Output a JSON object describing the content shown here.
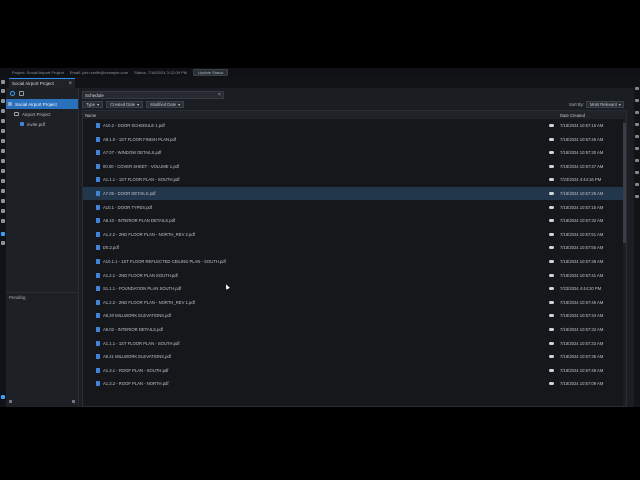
{
  "topbar": {
    "project": "Project: Social Airport Project",
    "user": "Email: john.smith@example.com",
    "status": "Status: 7/18/2024 3:12:09 PM",
    "update_label": "Update Status"
  },
  "tabs": [
    {
      "label": "Social Airport Project"
    }
  ],
  "sidebar": {
    "tree": [
      {
        "label": "Social Airport Project",
        "kind": "root",
        "selected": true
      },
      {
        "label": "Airport Project",
        "kind": "folder"
      },
      {
        "label": "invite.pdf",
        "kind": "pdf"
      }
    ],
    "pending_label": "Pending"
  },
  "search": {
    "value": "Schedule",
    "clear_icon": "close-icon"
  },
  "filters": [
    {
      "label": "Type"
    },
    {
      "label": "Created Date"
    },
    {
      "label": "Modified Date"
    }
  ],
  "sort": {
    "label": "Sort By:",
    "value": "Most Relevant"
  },
  "table": {
    "headers": {
      "name": "Name",
      "date": "Date Created"
    },
    "rows": [
      {
        "name": "A10.2 - DOOR SCHEDULE 1.pdf",
        "date": "7/18/2024 10:57:16 AM"
      },
      {
        "name": "A8.1.0 - 1ST FLOOR FINISH PLAN.pdf",
        "date": "7/18/2024 10:57:46 AM"
      },
      {
        "name": "A7.07 - WINDOW DETAILS.pdf",
        "date": "7/18/2024 10:57:30 AM"
      },
      {
        "name": "00.00 - COVER SHEET - VOLUME 1.pdf",
        "date": "7/18/2024 10:57:37 AM"
      },
      {
        "name": "A1.1.1 - 1ST FLOOR PLAN - SOUTH.pdf",
        "date": "7/23/2024 4:44:16 PM"
      },
      {
        "name": "A7.05 - DOOR DETAILS.pdf",
        "date": "7/18/2024 10:57:29 AM",
        "highlight": true
      },
      {
        "name": "A10.1 - DOOR TYPES.pdf",
        "date": "7/18/2024 10:57:15 AM"
      },
      {
        "name": "A8.10 - INTERIOR PLAN DETAILS.pdf",
        "date": "7/18/2024 10:57:32 AM"
      },
      {
        "name": "A1.2.2 - 2ND FLOOR PLAN - NORTH_REV 2.pdf",
        "date": "7/18/2024 10:57:51 AM"
      },
      {
        "name": "D0.2.pdf",
        "date": "7/18/2024 10:57:55 AM"
      },
      {
        "name": "A10.1.1 - 1ST FLOOR REFLECTED CEILING PLAN - SOUTH.pdf",
        "date": "7/18/2024 10:57:39 AM"
      },
      {
        "name": "A1.2.1 - 2ND FLOOR PLAN SOUTH.pdf",
        "date": "7/18/2024 10:57:41 AM"
      },
      {
        "name": "S1.1.1 - FOUNDATION PLAN SOUTH.pdf",
        "date": "7/23/2024 4:44:20 PM"
      },
      {
        "name": "A1.2.2 - 2ND FLOOR PLAN - NORTH_REV 1.pdf",
        "date": "7/18/2024 10:57:46 AM"
      },
      {
        "name": "A8.20 MILLWORK ELEVATIONS.pdf",
        "date": "7/18/2024 10:57:34 AM"
      },
      {
        "name": "A8.02 - INTERIOR DETAILS.pdf",
        "date": "7/18/2024 10:57:32 AM"
      },
      {
        "name": "A1.1.1 - 1ST FLOOR PLAN - SOUTH.pdf",
        "date": "7/18/2024 10:57:33 AM"
      },
      {
        "name": "A8.21 MILLWORK ELEVATIONS.pdf",
        "date": "7/18/2024 10:57:35 AM"
      },
      {
        "name": "A1.3.1 - ROOF PLAN - SOUTH.pdf",
        "date": "7/18/2024 10:57:48 AM"
      },
      {
        "name": "A1.3.2 - ROOF PLAN - NORTH.pdf",
        "date": "7/18/2024 10:57:09 AM"
      }
    ]
  },
  "colors": {
    "accent": "#2970bd",
    "highlight_row": "#22364c",
    "pdf_icon": "#3f86d6"
  }
}
